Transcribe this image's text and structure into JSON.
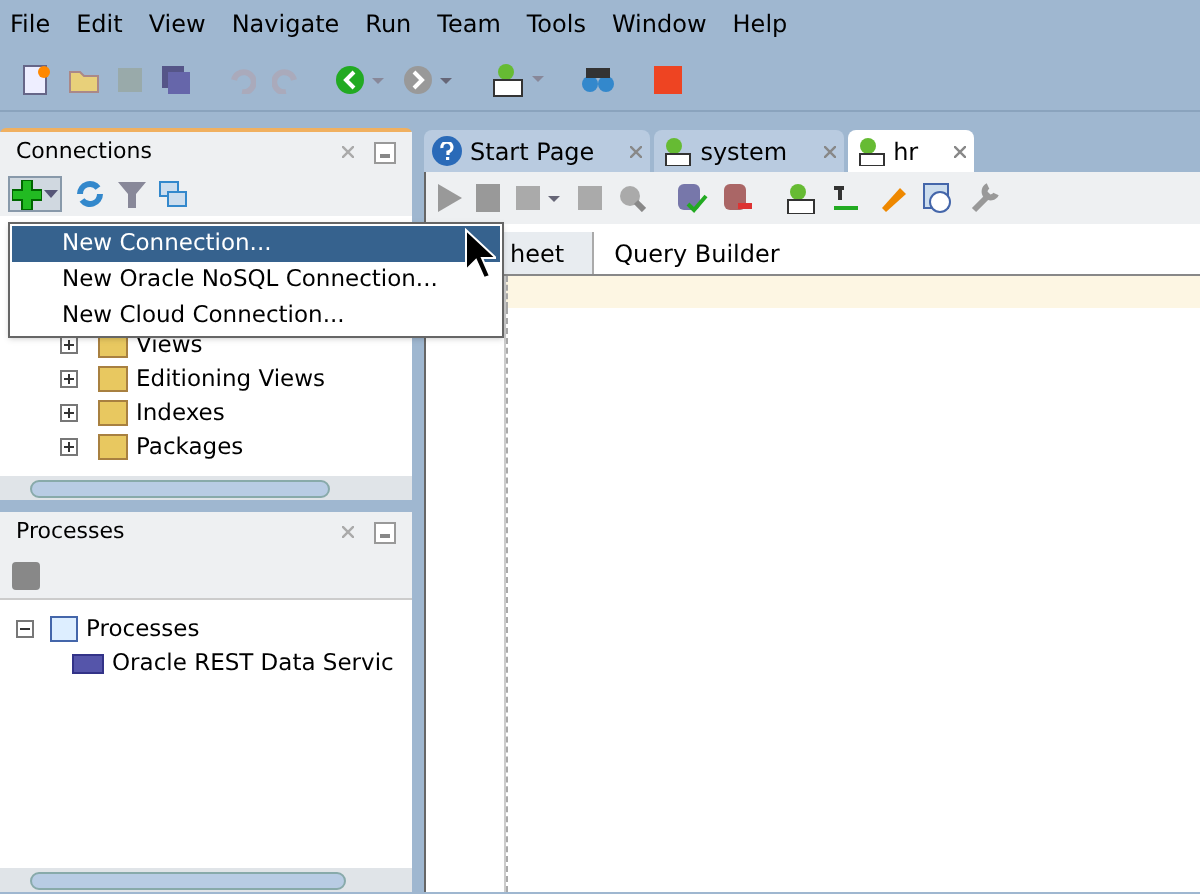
{
  "menu_bar": [
    "File",
    "Edit",
    "View",
    "Navigate",
    "Run",
    "Team",
    "Tools",
    "Window",
    "Help"
  ],
  "connections_panel": {
    "title": "Connections",
    "tree": [
      {
        "label": "Views",
        "expanded": false
      },
      {
        "label": "Editioning Views",
        "expanded": false
      },
      {
        "label": "Indexes",
        "expanded": false
      },
      {
        "label": "Packages",
        "expanded": false
      }
    ]
  },
  "new_menu": [
    {
      "label": "New Connection...",
      "selected": true
    },
    {
      "label": "New Oracle NoSQL Connection...",
      "selected": false
    },
    {
      "label": "New Cloud Connection...",
      "selected": false
    }
  ],
  "processes_panel": {
    "title": "Processes",
    "tree": [
      {
        "label": "Processes",
        "expanded": true,
        "children": [
          {
            "label": "Oracle REST Data Servic"
          }
        ]
      }
    ]
  },
  "editor_tabs": [
    {
      "label": "Start Page",
      "kind": "help",
      "selected": false
    },
    {
      "label": "system",
      "kind": "sql",
      "selected": false
    },
    {
      "label": "hr",
      "kind": "sql",
      "selected": true
    }
  ],
  "worksheet_tabs": [
    {
      "label": "heet",
      "selected": true
    },
    {
      "label": "Query Builder",
      "selected": false
    }
  ]
}
